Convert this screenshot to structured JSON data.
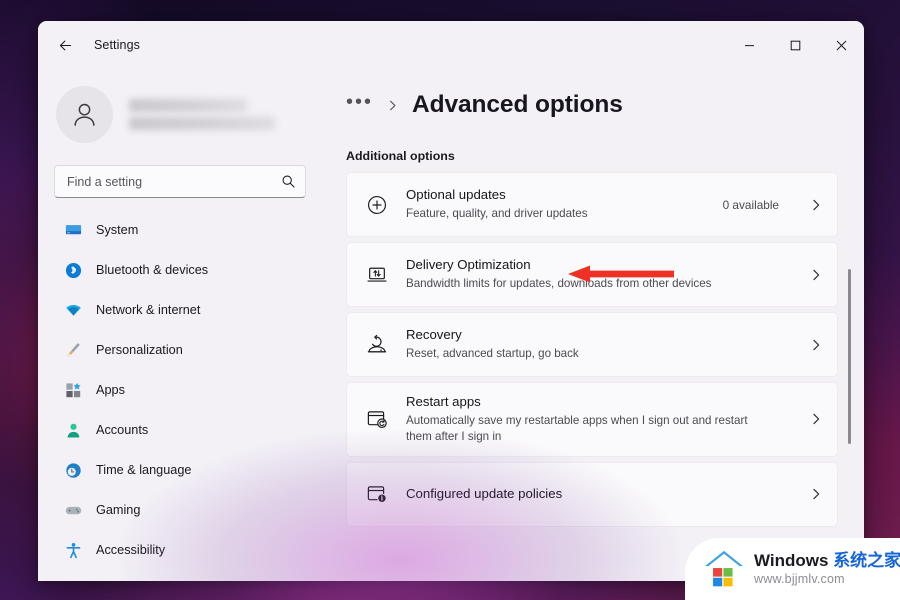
{
  "window": {
    "app_title": "Settings",
    "back_icon": "back-arrow-icon",
    "controls": {
      "minimize": "minimize-icon",
      "maximize": "maximize-icon",
      "close": "close-icon"
    }
  },
  "sidebar": {
    "account": {
      "avatar_icon": "person-avatar-icon",
      "name_redacted": "",
      "email_redacted": ""
    },
    "search": {
      "placeholder": "Find a setting",
      "value": "",
      "icon": "search-icon"
    },
    "items": [
      {
        "label": "System",
        "icon": "monitor-icon"
      },
      {
        "label": "Bluetooth & devices",
        "icon": "bluetooth-icon"
      },
      {
        "label": "Network & internet",
        "icon": "wifi-icon"
      },
      {
        "label": "Personalization",
        "icon": "paintbrush-icon"
      },
      {
        "label": "Apps",
        "icon": "apps-grid-icon"
      },
      {
        "label": "Accounts",
        "icon": "person-icon"
      },
      {
        "label": "Time & language",
        "icon": "clock-globe-icon"
      },
      {
        "label": "Gaming",
        "icon": "gamepad-icon"
      },
      {
        "label": "Accessibility",
        "icon": "accessibility-icon"
      }
    ]
  },
  "main": {
    "breadcrumb": {
      "overflow_label": "•••",
      "separator_icon": "chevron-right-icon",
      "current": "Advanced options"
    },
    "section_heading": "Additional options",
    "cards": [
      {
        "title": "Optional updates",
        "subtitle": "Feature, quality, and driver updates",
        "right_text": "0 available",
        "icon": "plus-circle-icon",
        "chevron": "chevron-right-icon"
      },
      {
        "title": "Delivery Optimization",
        "subtitle": "Bandwidth limits for updates, downloads from other devices",
        "right_text": "",
        "icon": "laptop-updown-arrows-icon",
        "chevron": "chevron-right-icon"
      },
      {
        "title": "Recovery",
        "subtitle": "Reset, advanced startup, go back",
        "right_text": "",
        "icon": "recovery-arrow-icon",
        "chevron": "chevron-right-icon"
      },
      {
        "title": "Restart apps",
        "subtitle": "Automatically save my restartable apps when I sign out and restart them after I sign in",
        "right_text": "",
        "icon": "window-refresh-icon",
        "chevron": "chevron-right-icon"
      },
      {
        "title": "Configured update policies",
        "subtitle": "",
        "right_text": "",
        "icon": "window-info-icon",
        "chevron": "chevron-right-icon"
      }
    ],
    "annotation": {
      "type": "red-arrow",
      "points_to": "Delivery Optimization",
      "color": "#ee3124"
    },
    "scrollbar": {
      "icon": "vertical-scrollbar"
    }
  },
  "watermark": {
    "brand": "Windows ",
    "brand_cn": "系统之家",
    "url": "www.bjjmlv.com",
    "logo_icon": "windows-house-logo-icon"
  },
  "colors": {
    "window_bg": "#f3f0f6",
    "card_bg": "#faf9fb",
    "accent_red": "#ee3124",
    "text_primary": "#1b1a1f",
    "text_secondary": "#4c4a52",
    "link_blue": "#1565d8"
  }
}
